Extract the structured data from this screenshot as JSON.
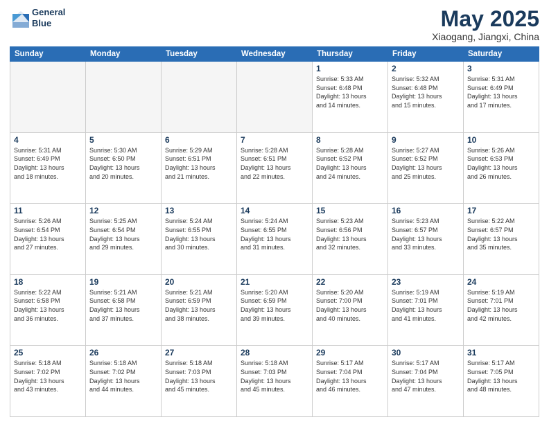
{
  "logo": {
    "line1": "General",
    "line2": "Blue"
  },
  "title": "May 2025",
  "subtitle": "Xiaogang, Jiangxi, China",
  "weekdays": [
    "Sunday",
    "Monday",
    "Tuesday",
    "Wednesday",
    "Thursday",
    "Friday",
    "Saturday"
  ],
  "weeks": [
    [
      {
        "day": "",
        "info": ""
      },
      {
        "day": "",
        "info": ""
      },
      {
        "day": "",
        "info": ""
      },
      {
        "day": "",
        "info": ""
      },
      {
        "day": "1",
        "info": "Sunrise: 5:33 AM\nSunset: 6:48 PM\nDaylight: 13 hours\nand 14 minutes."
      },
      {
        "day": "2",
        "info": "Sunrise: 5:32 AM\nSunset: 6:48 PM\nDaylight: 13 hours\nand 15 minutes."
      },
      {
        "day": "3",
        "info": "Sunrise: 5:31 AM\nSunset: 6:49 PM\nDaylight: 13 hours\nand 17 minutes."
      }
    ],
    [
      {
        "day": "4",
        "info": "Sunrise: 5:31 AM\nSunset: 6:49 PM\nDaylight: 13 hours\nand 18 minutes."
      },
      {
        "day": "5",
        "info": "Sunrise: 5:30 AM\nSunset: 6:50 PM\nDaylight: 13 hours\nand 20 minutes."
      },
      {
        "day": "6",
        "info": "Sunrise: 5:29 AM\nSunset: 6:51 PM\nDaylight: 13 hours\nand 21 minutes."
      },
      {
        "day": "7",
        "info": "Sunrise: 5:28 AM\nSunset: 6:51 PM\nDaylight: 13 hours\nand 22 minutes."
      },
      {
        "day": "8",
        "info": "Sunrise: 5:28 AM\nSunset: 6:52 PM\nDaylight: 13 hours\nand 24 minutes."
      },
      {
        "day": "9",
        "info": "Sunrise: 5:27 AM\nSunset: 6:52 PM\nDaylight: 13 hours\nand 25 minutes."
      },
      {
        "day": "10",
        "info": "Sunrise: 5:26 AM\nSunset: 6:53 PM\nDaylight: 13 hours\nand 26 minutes."
      }
    ],
    [
      {
        "day": "11",
        "info": "Sunrise: 5:26 AM\nSunset: 6:54 PM\nDaylight: 13 hours\nand 27 minutes."
      },
      {
        "day": "12",
        "info": "Sunrise: 5:25 AM\nSunset: 6:54 PM\nDaylight: 13 hours\nand 29 minutes."
      },
      {
        "day": "13",
        "info": "Sunrise: 5:24 AM\nSunset: 6:55 PM\nDaylight: 13 hours\nand 30 minutes."
      },
      {
        "day": "14",
        "info": "Sunrise: 5:24 AM\nSunset: 6:55 PM\nDaylight: 13 hours\nand 31 minutes."
      },
      {
        "day": "15",
        "info": "Sunrise: 5:23 AM\nSunset: 6:56 PM\nDaylight: 13 hours\nand 32 minutes."
      },
      {
        "day": "16",
        "info": "Sunrise: 5:23 AM\nSunset: 6:57 PM\nDaylight: 13 hours\nand 33 minutes."
      },
      {
        "day": "17",
        "info": "Sunrise: 5:22 AM\nSunset: 6:57 PM\nDaylight: 13 hours\nand 35 minutes."
      }
    ],
    [
      {
        "day": "18",
        "info": "Sunrise: 5:22 AM\nSunset: 6:58 PM\nDaylight: 13 hours\nand 36 minutes."
      },
      {
        "day": "19",
        "info": "Sunrise: 5:21 AM\nSunset: 6:58 PM\nDaylight: 13 hours\nand 37 minutes."
      },
      {
        "day": "20",
        "info": "Sunrise: 5:21 AM\nSunset: 6:59 PM\nDaylight: 13 hours\nand 38 minutes."
      },
      {
        "day": "21",
        "info": "Sunrise: 5:20 AM\nSunset: 6:59 PM\nDaylight: 13 hours\nand 39 minutes."
      },
      {
        "day": "22",
        "info": "Sunrise: 5:20 AM\nSunset: 7:00 PM\nDaylight: 13 hours\nand 40 minutes."
      },
      {
        "day": "23",
        "info": "Sunrise: 5:19 AM\nSunset: 7:01 PM\nDaylight: 13 hours\nand 41 minutes."
      },
      {
        "day": "24",
        "info": "Sunrise: 5:19 AM\nSunset: 7:01 PM\nDaylight: 13 hours\nand 42 minutes."
      }
    ],
    [
      {
        "day": "25",
        "info": "Sunrise: 5:18 AM\nSunset: 7:02 PM\nDaylight: 13 hours\nand 43 minutes."
      },
      {
        "day": "26",
        "info": "Sunrise: 5:18 AM\nSunset: 7:02 PM\nDaylight: 13 hours\nand 44 minutes."
      },
      {
        "day": "27",
        "info": "Sunrise: 5:18 AM\nSunset: 7:03 PM\nDaylight: 13 hours\nand 45 minutes."
      },
      {
        "day": "28",
        "info": "Sunrise: 5:18 AM\nSunset: 7:03 PM\nDaylight: 13 hours\nand 45 minutes."
      },
      {
        "day": "29",
        "info": "Sunrise: 5:17 AM\nSunset: 7:04 PM\nDaylight: 13 hours\nand 46 minutes."
      },
      {
        "day": "30",
        "info": "Sunrise: 5:17 AM\nSunset: 7:04 PM\nDaylight: 13 hours\nand 47 minutes."
      },
      {
        "day": "31",
        "info": "Sunrise: 5:17 AM\nSunset: 7:05 PM\nDaylight: 13 hours\nand 48 minutes."
      }
    ]
  ]
}
